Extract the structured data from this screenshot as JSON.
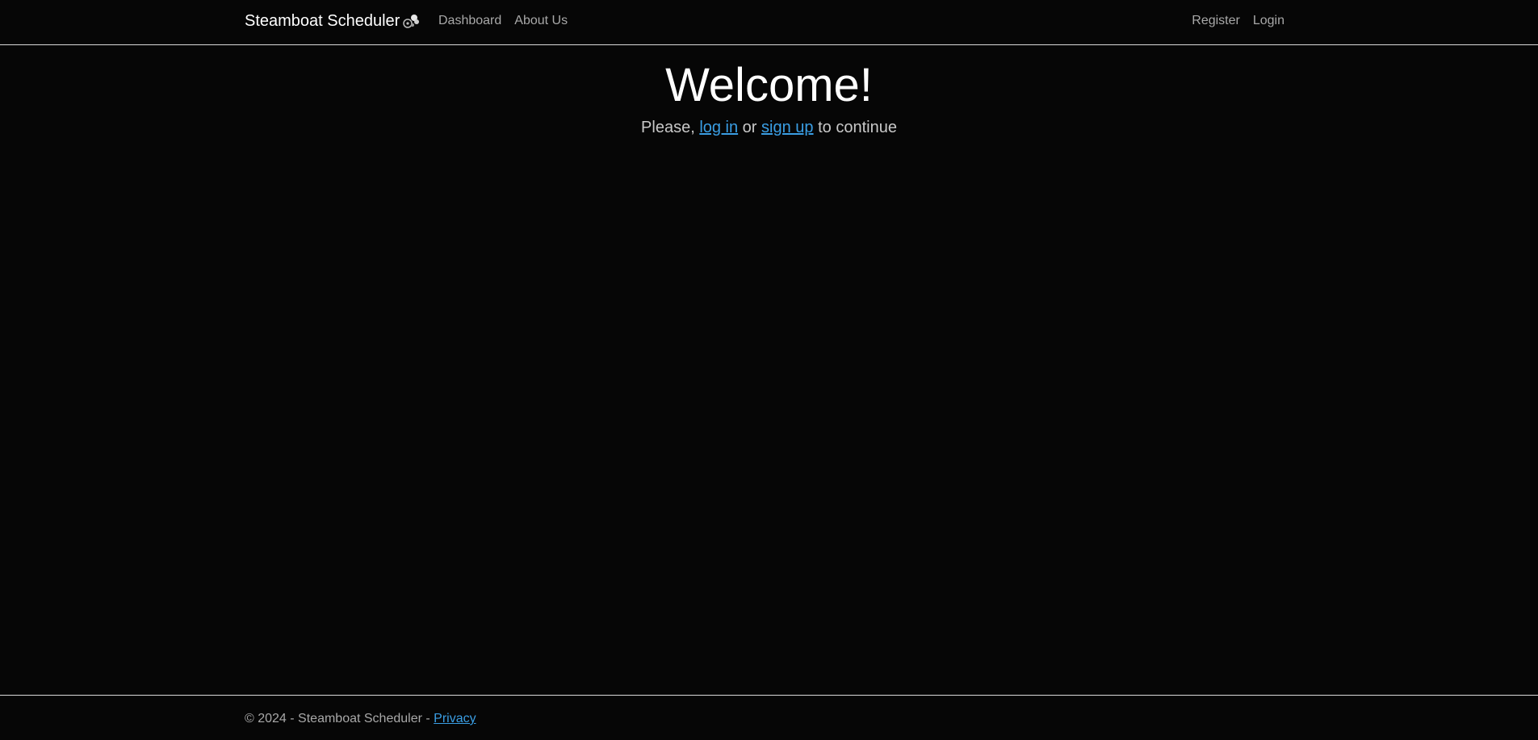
{
  "navbar": {
    "brand": "Steamboat Scheduler",
    "brand_icon": "steamboat-logo-icon",
    "left_links": [
      {
        "label": "Dashboard"
      },
      {
        "label": "About Us"
      }
    ],
    "right_links": [
      {
        "label": "Register"
      },
      {
        "label": "Login"
      }
    ]
  },
  "main": {
    "heading": "Welcome!",
    "lead_prefix": "Please, ",
    "login_link": "log in",
    "lead_middle": " or ",
    "signup_link": "sign up",
    "lead_suffix": " to continue"
  },
  "footer": {
    "text": "© 2024 - Steamboat Scheduler - ",
    "privacy_link": "Privacy"
  },
  "colors": {
    "background": "#060606",
    "link": "#3a9ee4",
    "nav_text": "#a8a8a8"
  }
}
